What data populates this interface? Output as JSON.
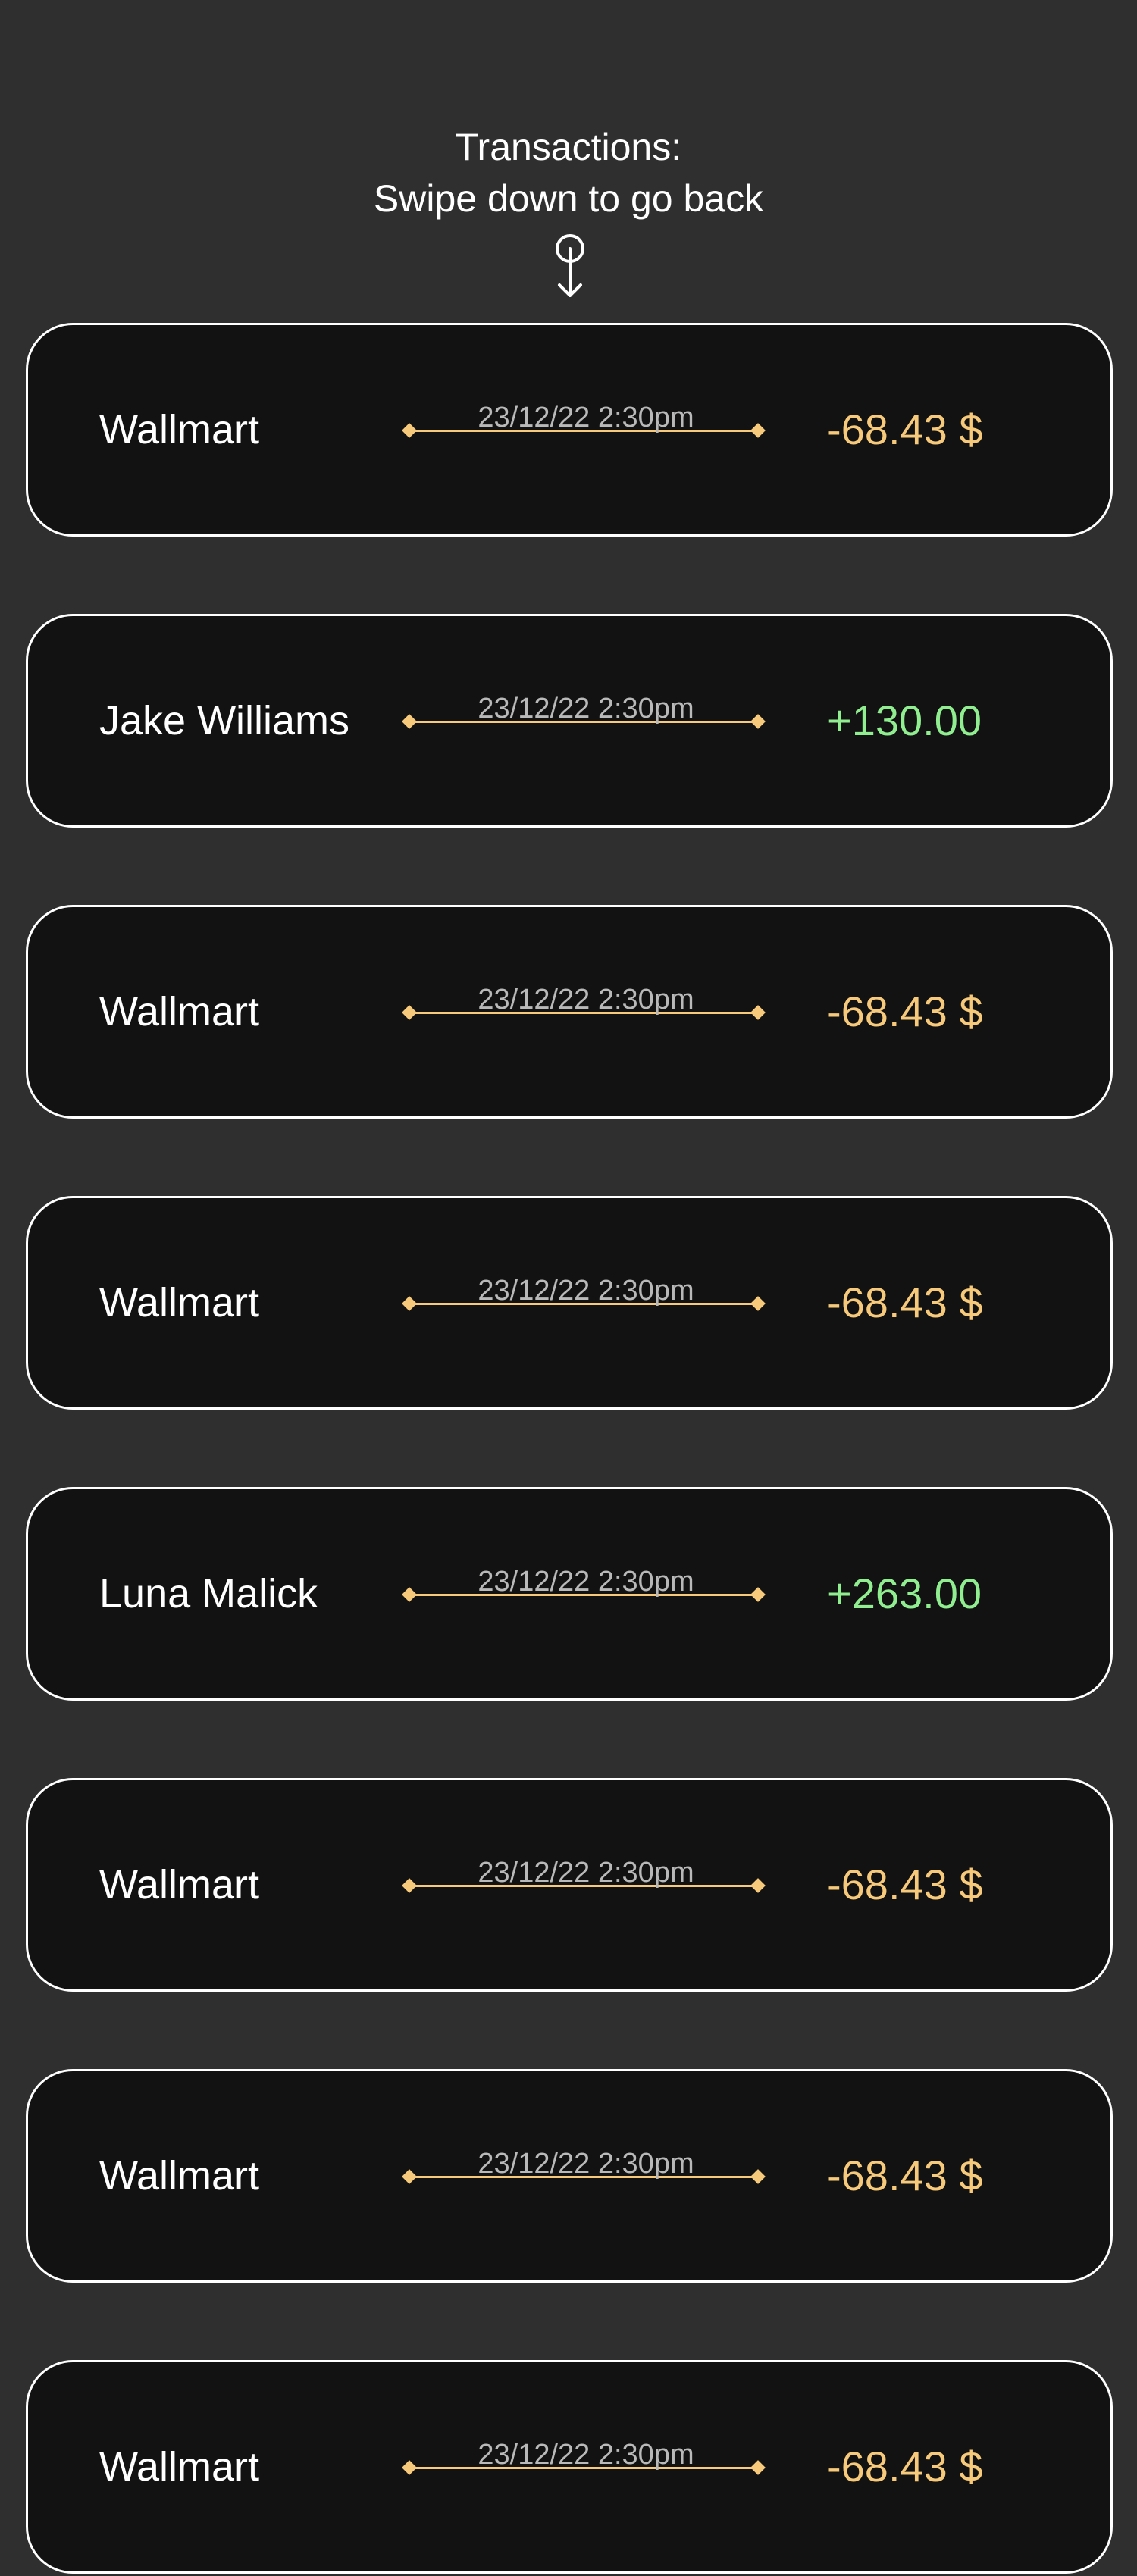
{
  "header": {
    "line1": "Transactions:",
    "line2": "Swipe down to go back",
    "icon": "swipe-down-icon"
  },
  "colors": {
    "background": "#2f2f2f",
    "card_background": "#121212",
    "card_border": "#ffffff",
    "debit": "#f6c97b",
    "credit": "#90ee90",
    "date_text": "#b9b9b9",
    "timeline": "#f6c97b"
  },
  "transactions": [
    {
      "name": "Wallmart",
      "date": "23/12/22 2:30pm",
      "amount": "-68.43 $",
      "type": "debit"
    },
    {
      "name": "Jake Williams",
      "date": "23/12/22 2:30pm",
      "amount": "+130.00",
      "type": "credit"
    },
    {
      "name": "Wallmart",
      "date": "23/12/22 2:30pm",
      "amount": "-68.43 $",
      "type": "debit"
    },
    {
      "name": "Wallmart",
      "date": "23/12/22 2:30pm",
      "amount": "-68.43 $",
      "type": "debit"
    },
    {
      "name": "Luna Malick",
      "date": "23/12/22 2:30pm",
      "amount": "+263.00",
      "type": "credit"
    },
    {
      "name": "Wallmart",
      "date": "23/12/22 2:30pm",
      "amount": "-68.43 $",
      "type": "debit"
    },
    {
      "name": "Wallmart",
      "date": "23/12/22 2:30pm",
      "amount": "-68.43 $",
      "type": "debit"
    },
    {
      "name": "Wallmart",
      "date": "23/12/22 2:30pm",
      "amount": "-68.43 $",
      "type": "debit"
    }
  ]
}
